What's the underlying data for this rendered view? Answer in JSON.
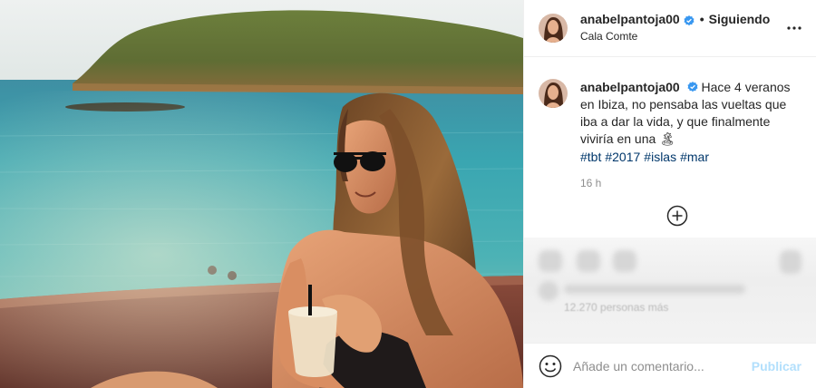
{
  "post": {
    "username": "anabelpantoja00",
    "verified": true,
    "separator": "•",
    "follow_status": "Siguiendo",
    "location": "Cala Comte",
    "more_options_icon": "more-horizontal-icon",
    "caption": {
      "text": "Hace 4 veranos en Ibiza, no pensaba las vueltas que iba a dar la vida, y que finalmente viviría en una",
      "emoji": "🏝",
      "hashtags": [
        "#tbt",
        "#2017",
        "#islas",
        "#mar"
      ]
    },
    "timestamp": "16 h",
    "load_more_icon": "plus-circle-icon",
    "blurred_text": "12.270 personas más",
    "comment": {
      "placeholder": "Añade un comentario...",
      "emoji_icon": "emoji-icon",
      "publish_label": "Publicar"
    }
  },
  "colors": {
    "verified_badge": "#3897f0",
    "link": "#00376b",
    "muted": "#8e8e8e",
    "publish_disabled": "#b2dffc",
    "border": "#efefef"
  }
}
